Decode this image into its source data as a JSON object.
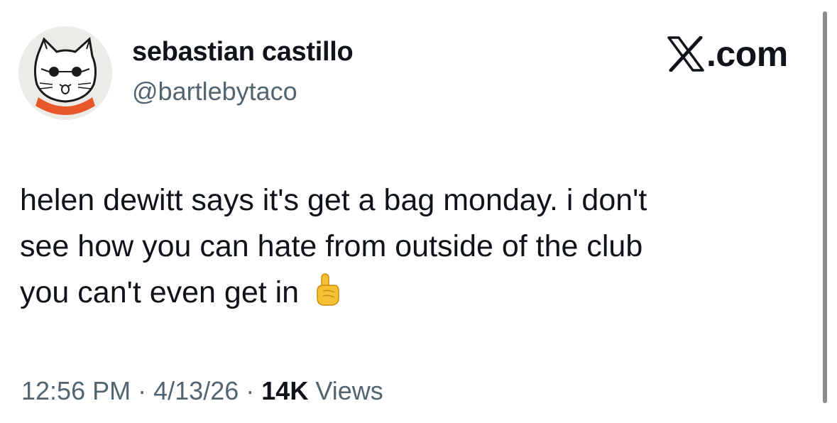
{
  "author": {
    "avatar": "cat-with-sunglasses-avatar",
    "display_name": "sebastian castillo",
    "handle": "@bartlebytaco"
  },
  "brand": {
    "logo_icon": "x-logo-icon",
    "domain_suffix": ".com"
  },
  "tweet": {
    "lines": [
      "helen dewitt says it's get a bag monday. i don't",
      "see how you can hate from outside of the club",
      "you can't even get in"
    ],
    "emoji": "index-pointing-up-emoji"
  },
  "meta": {
    "time": "12:56 PM",
    "separator": "·",
    "date": "4/13/26",
    "views_count": "14K",
    "views_label": "Views"
  },
  "colors": {
    "text": "#0f1419",
    "secondary_text": "#536471",
    "scarf": "#e8572a",
    "emoji": "#f5c033"
  }
}
